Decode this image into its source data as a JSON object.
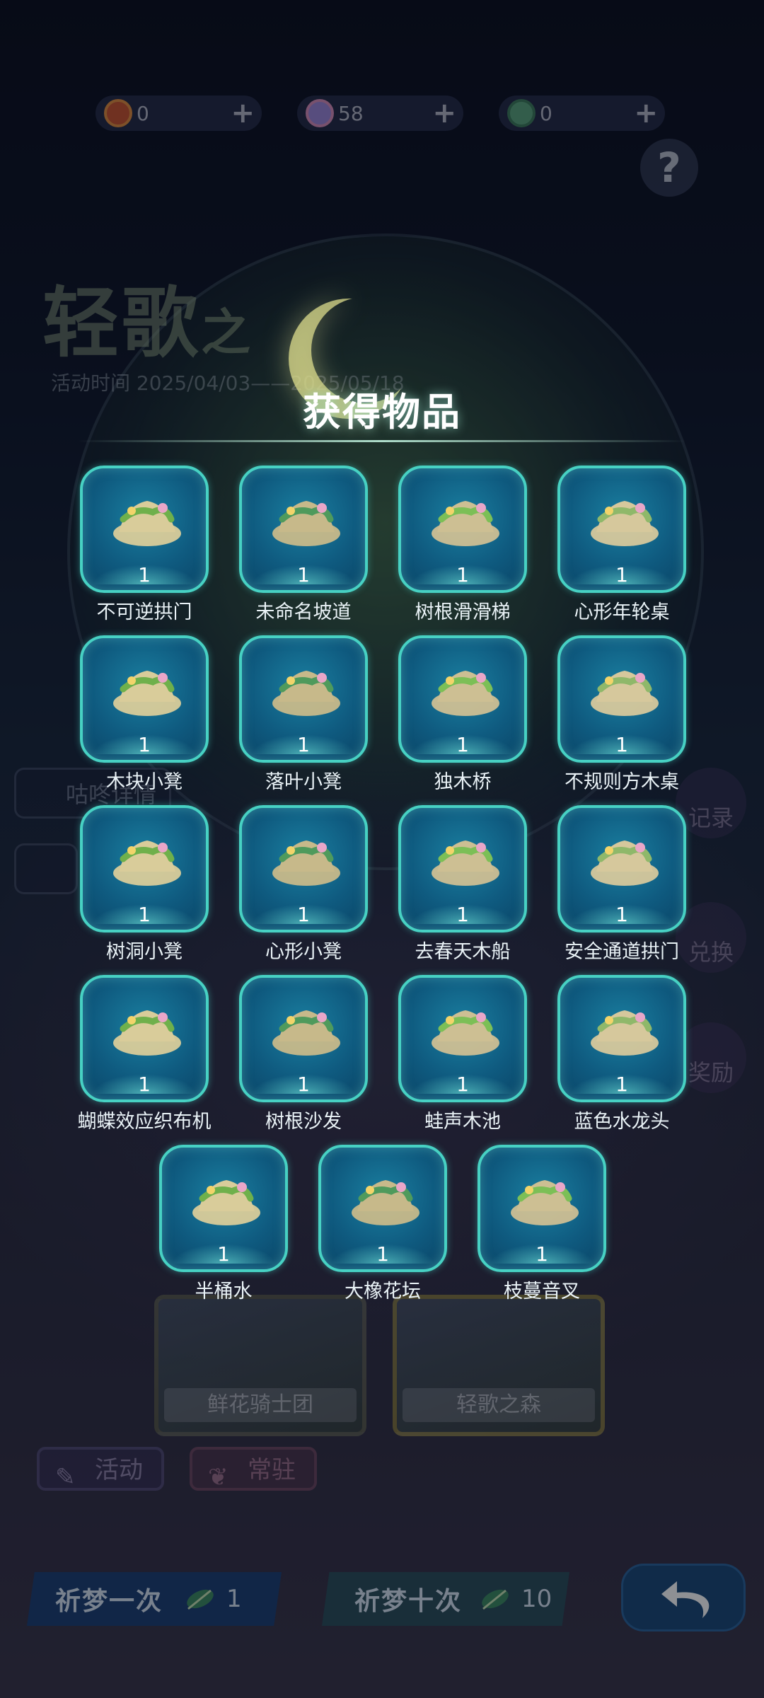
{
  "currencies": [
    {
      "value": "0",
      "icon": "flower-coin-icon",
      "color": "#c9532f"
    },
    {
      "value": "58",
      "icon": "moon-gem-icon",
      "color": "#9b86d8"
    },
    {
      "value": "0",
      "icon": "feather-icon",
      "color": "#5aa37a"
    }
  ],
  "currency_plus": "+",
  "help_label": "?",
  "background": {
    "event_title": "轻歌",
    "event_title_small": "之",
    "event_date": "活动时间 2025/04/03——2025/05/18",
    "side_labels": [
      "咕咚详情"
    ],
    "right_buttons": [
      "记录",
      "兑换",
      "奖励"
    ],
    "cards": [
      "鲜花骑士团",
      "轻歌之森"
    ],
    "tabs": [
      "活动",
      "常驻"
    ]
  },
  "popup": {
    "title": "获得物品",
    "items": [
      {
        "name": "不可逆拱门",
        "qty": "1",
        "icon": "arch-icon"
      },
      {
        "name": "未命名坡道",
        "qty": "1",
        "icon": "ramp-icon"
      },
      {
        "name": "树根滑滑梯",
        "qty": "1",
        "icon": "root-slide-icon"
      },
      {
        "name": "心形年轮桌",
        "qty": "1",
        "icon": "heart-table-icon"
      },
      {
        "name": "木块小凳",
        "qty": "1",
        "icon": "wood-stool-icon"
      },
      {
        "name": "落叶小凳",
        "qty": "1",
        "icon": "leaf-stool-icon"
      },
      {
        "name": "独木桥",
        "qty": "1",
        "icon": "log-bridge-icon"
      },
      {
        "name": "不规则方木桌",
        "qty": "1",
        "icon": "square-table-icon"
      },
      {
        "name": "树洞小凳",
        "qty": "1",
        "icon": "hollow-stool-icon"
      },
      {
        "name": "心形小凳",
        "qty": "1",
        "icon": "heart-stool-icon"
      },
      {
        "name": "去春天木船",
        "qty": "1",
        "icon": "boat-icon"
      },
      {
        "name": "安全通道拱门",
        "qty": "1",
        "icon": "flower-arch-icon"
      },
      {
        "name": "蝴蝶效应织布机",
        "qty": "1",
        "icon": "loom-icon"
      },
      {
        "name": "树根沙发",
        "qty": "1",
        "icon": "root-sofa-icon"
      },
      {
        "name": "蛙声木池",
        "qty": "1",
        "icon": "pond-icon"
      },
      {
        "name": "蓝色水龙头",
        "qty": "1",
        "icon": "faucet-icon"
      },
      {
        "name": "半桶水",
        "qty": "1",
        "icon": "bucket-icon"
      },
      {
        "name": "大橡花坛",
        "qty": "1",
        "icon": "planter-icon"
      },
      {
        "name": "枝蔓音叉",
        "qty": "1",
        "icon": "vine-fork-icon"
      }
    ]
  },
  "buttons": {
    "pray_once": "祈梦一次",
    "pray_once_cost": "1",
    "pray_ten": "祈梦十次",
    "pray_ten_cost": "10"
  }
}
